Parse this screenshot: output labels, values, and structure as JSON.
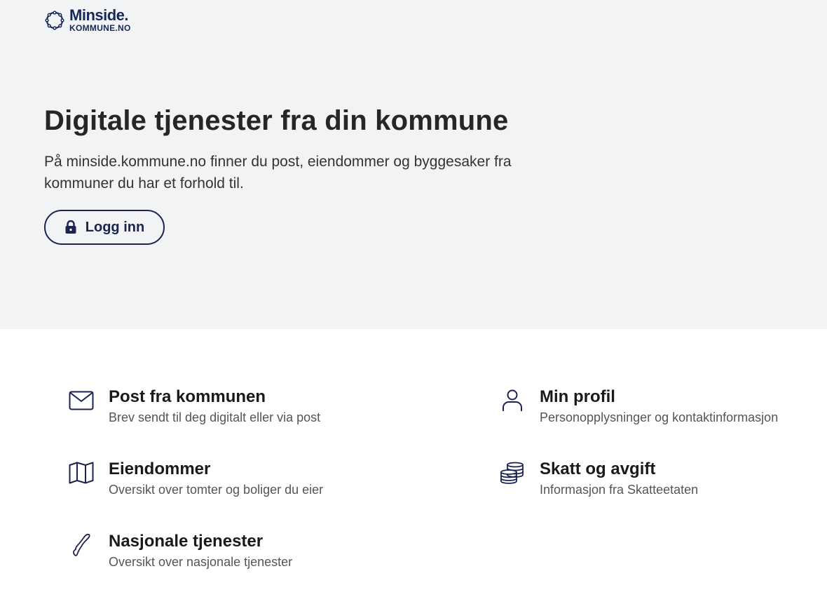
{
  "header": {
    "logo_main": "Minside.",
    "logo_sub": "KOMMUNE.NO"
  },
  "hero": {
    "title": "Digitale tjenester fra din kommune",
    "description": "På minside.kommune.no finner du post, eiendommer og byggesaker fra kommuner du har et forhold til.",
    "login_label": "Logg inn",
    "background": "#f2f3f5",
    "accent": "#1b2450"
  },
  "services": [
    {
      "title": "Post fra kommunen",
      "subtitle": "Brev sendt til deg digitalt eller via post",
      "icon": "envelope-icon"
    },
    {
      "title": "Min profil",
      "subtitle": "Personopplysninger og kontaktinformasjon",
      "icon": "person-icon"
    },
    {
      "title": "Eiendommer",
      "subtitle": "Oversikt over tomter og boliger du eier",
      "icon": "map-icon"
    },
    {
      "title": "Skatt og avgift",
      "subtitle": "Informasjon fra Skatteetaten",
      "icon": "coins-icon"
    },
    {
      "title": "Nasjonale tjenester",
      "subtitle": "Oversikt over nasjonale tjenester",
      "icon": "norway-map-icon"
    }
  ]
}
